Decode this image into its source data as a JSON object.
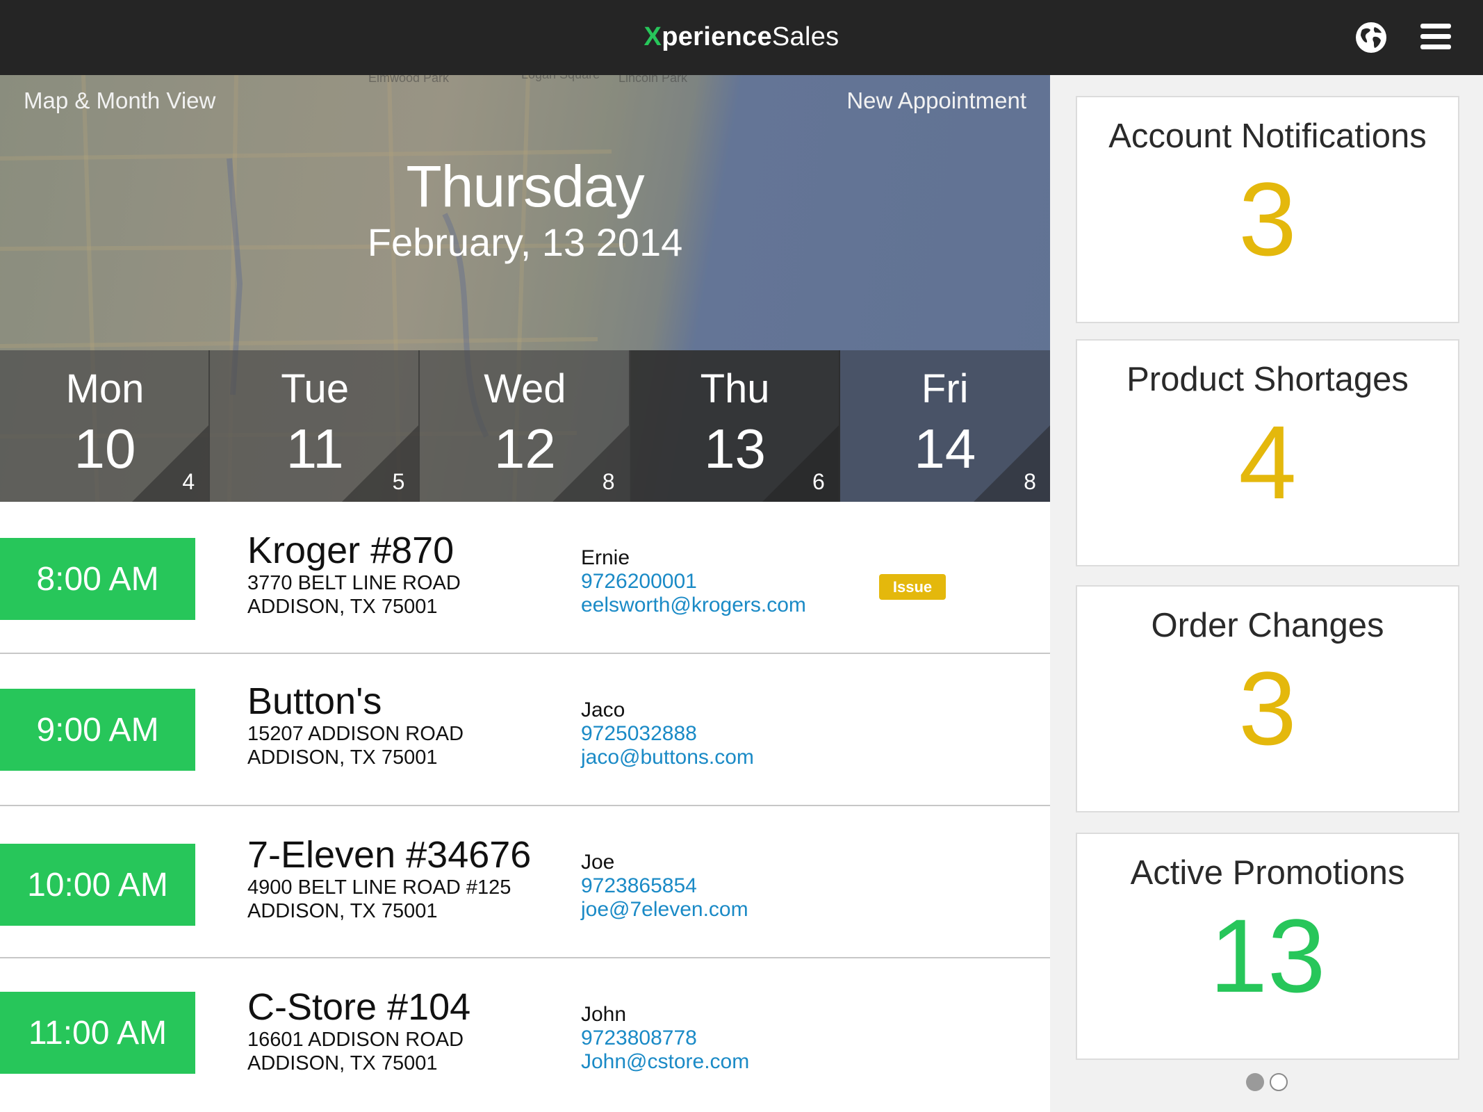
{
  "header": {
    "brand_x": "X",
    "brand_bold": "perience",
    "brand_rest": "Sales",
    "globe_icon": "globe-icon",
    "menu_icon": "hamburger-menu-icon"
  },
  "hero": {
    "map_link": "Map & Month  View",
    "new_appointment_link": "New Appointment",
    "day": "Thursday",
    "date": "February, 13 2014",
    "map_labels": [
      "Elmwood Park",
      "Logan Square",
      "Lincoln Park"
    ]
  },
  "week": [
    {
      "name": "Mon",
      "num": "10",
      "count": "4",
      "selected": false
    },
    {
      "name": "Tue",
      "num": "11",
      "count": "5",
      "selected": false
    },
    {
      "name": "Wed",
      "num": "12",
      "count": "8",
      "selected": false
    },
    {
      "name": "Thu",
      "num": "13",
      "count": "6",
      "selected": true
    },
    {
      "name": "Fri",
      "num": "14",
      "count": "8",
      "selected": false
    }
  ],
  "appointments": [
    {
      "time": "8:00 AM",
      "store": "Kroger  #870",
      "address1": "3770 BELT LINE ROAD",
      "address2": "ADDISON, TX 75001",
      "contact": "Ernie",
      "phone": "9726200001",
      "email": "eelsworth@krogers.com",
      "badge": "Issue"
    },
    {
      "time": "9:00 AM",
      "store": "Button's",
      "address1": "15207 ADDISON ROAD",
      "address2": "ADDISON, TX 75001",
      "contact": "Jaco",
      "phone": "9725032888",
      "email": "jaco@buttons.com",
      "badge": ""
    },
    {
      "time": "10:00 AM",
      "store": "7-Eleven #34676",
      "address1": "4900 BELT LINE ROAD #125",
      "address2": "ADDISON, TX 75001",
      "contact": "Joe",
      "phone": "9723865854",
      "email": "joe@7eleven.com",
      "badge": ""
    },
    {
      "time": "11:00 AM",
      "store": "C-Store #104",
      "address1": "16601 ADDISON ROAD",
      "address2": "ADDISON, TX 75001",
      "contact": "John",
      "phone": "9723808778",
      "email": "John@cstore.com",
      "badge": ""
    }
  ],
  "cards": [
    {
      "title": "Account Notifications",
      "value": "3",
      "color": "#e4b80c"
    },
    {
      "title": "Product Shortages",
      "value": "4",
      "color": "#e4b80c"
    },
    {
      "title": "Order Changes",
      "value": "3",
      "color": "#e4b80c"
    },
    {
      "title": "Active Promotions",
      "value": "13",
      "color": "#27c65a"
    }
  ],
  "pager": {
    "pages": 2,
    "active": 1
  },
  "colors": {
    "accent_green": "#27c65a",
    "accent_yellow": "#e4b80c",
    "link_blue": "#1a8ac6",
    "topbar": "#252525"
  }
}
